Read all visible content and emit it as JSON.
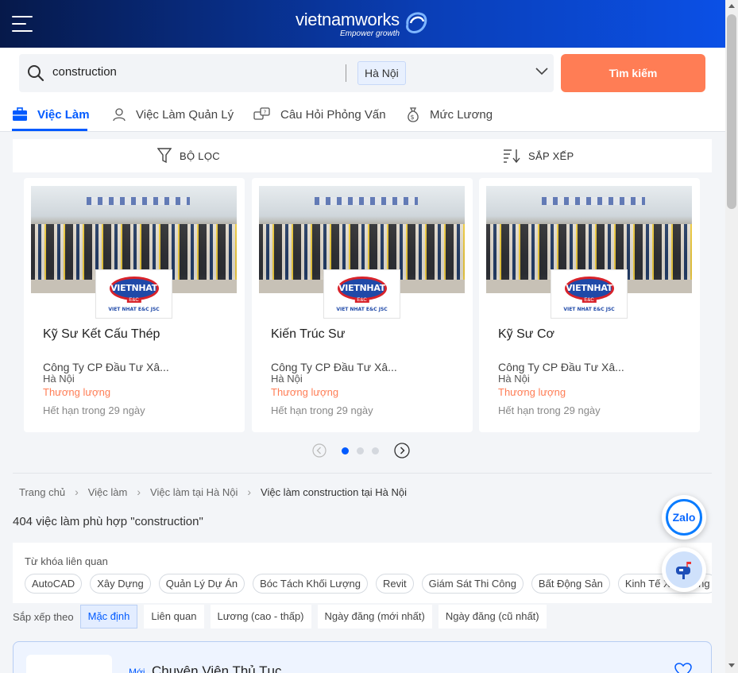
{
  "header": {
    "logo_text": "vietnamworks",
    "logo_tagline": "Empower growth"
  },
  "search": {
    "query": "construction",
    "location": "Hà Nội",
    "button_label": "Tìm kiếm"
  },
  "tabs": [
    {
      "label": "Việc Làm",
      "icon": "briefcase-icon"
    },
    {
      "label": "Việc Làm Quản Lý",
      "icon": "manager-icon"
    },
    {
      "label": "Câu Hỏi Phỏng Vấn",
      "icon": "interview-icon"
    },
    {
      "label": "Mức Lương",
      "icon": "money-bag-icon"
    }
  ],
  "filter": {
    "filter_label": "BỘ LỌC",
    "sort_label": "SẮP XẾP"
  },
  "featured_jobs": [
    {
      "title": "Kỹ Sư Kết Cấu Thép",
      "company": "Công Ty CP Đầu Tư Xâ...",
      "location": "Hà Nội",
      "salary": "Thương lượng",
      "expiry": "Hết hạn trong 29 ngày",
      "logo_text": "VIETNHAT",
      "logo_sub": "E&C",
      "logo_caption": "VIET NHAT E&C JSC"
    },
    {
      "title": "Kiến Trúc Sư",
      "company": "Công Ty CP Đầu Tư Xâ...",
      "location": "Hà Nội",
      "salary": "Thương lượng",
      "expiry": "Hết hạn trong 29 ngày",
      "logo_text": "VIETNHAT",
      "logo_sub": "E&C",
      "logo_caption": "VIET NHAT E&C JSC"
    },
    {
      "title": "Kỹ Sư Cơ",
      "company": "Công Ty CP Đầu Tư Xâ...",
      "location": "Hà Nội",
      "salary": "Thương lượng",
      "expiry": "Hết hạn trong 29 ngày",
      "logo_text": "VIETNHAT",
      "logo_sub": "E&C",
      "logo_caption": "VIET NHAT E&C JSC"
    }
  ],
  "carousel": {
    "pages": 3,
    "active_page": 1
  },
  "breadcrumb": [
    "Trang chủ",
    "Việc làm",
    "Việc làm tại Hà Nội",
    "Việc làm construction tại Hà Nội"
  ],
  "results": {
    "count_text": "404 việc làm phù hợp \"construction\""
  },
  "related_keywords": {
    "title": "Từ khóa liên quan",
    "items": [
      "AutoCAD",
      "Xây Dựng",
      "Quản Lý Dự Án",
      "Bóc Tách Khối Lượng",
      "Revit",
      "Giám Sát Thi Công",
      "Bất Động Sản",
      "Kinh Tế Xây Dựng"
    ]
  },
  "sort": {
    "label": "Sắp xếp theo",
    "options": [
      "Mặc định",
      "Liên quan",
      "Lương (cao - thấp)",
      "Ngày đăng (mới nhất)",
      "Ngày đăng (cũ nhất)"
    ],
    "active": "Mặc định"
  },
  "job_list": [
    {
      "badge": "Mới",
      "title": "Chuyên Viên Thủ Tục"
    }
  ],
  "floating": {
    "zalo_label": "Zalo"
  },
  "colors": {
    "brand_blue": "#005aff",
    "accent_orange": "#ff7d55",
    "header_dark": "#06194a"
  }
}
